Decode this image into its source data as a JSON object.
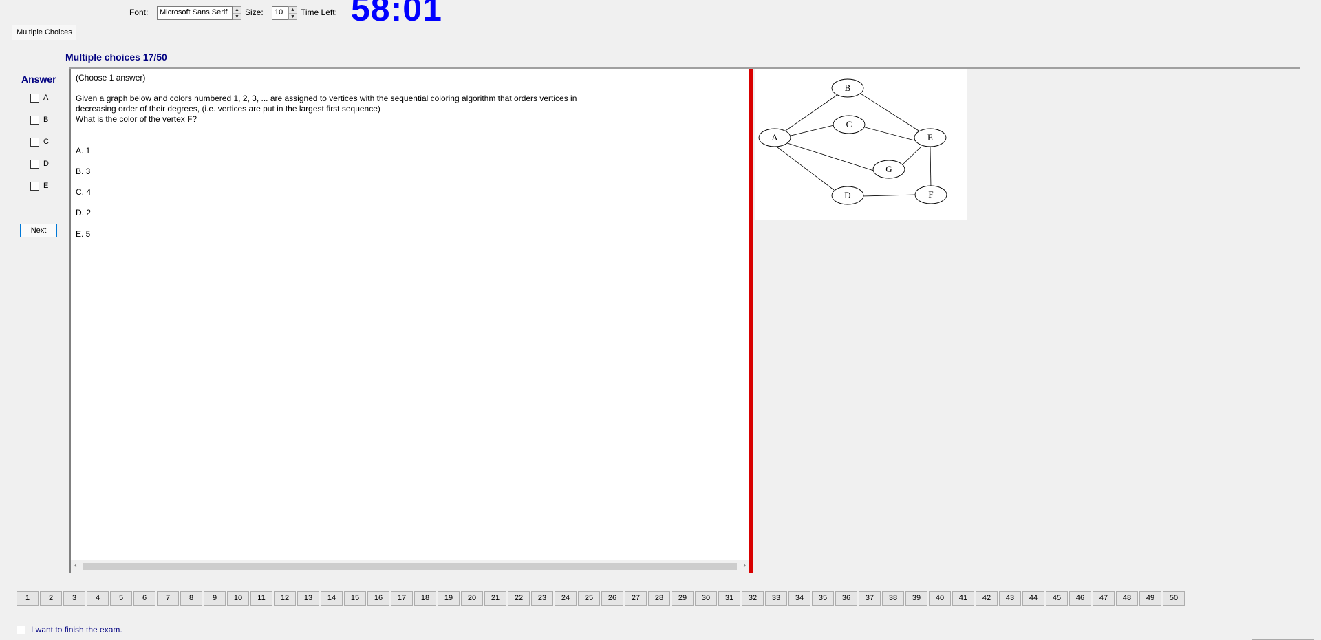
{
  "toolbar": {
    "font_label": "Font:",
    "font_value": "Microsoft Sans Serif",
    "size_label": "Size:",
    "size_value": "10",
    "time_label": "Time Left:",
    "time_value": "58:01"
  },
  "tab_label": "Multiple Choices",
  "section_title": "Multiple choices 17/50",
  "answer_title": "Answer",
  "answer_options": [
    "A",
    "B",
    "C",
    "D",
    "E"
  ],
  "next_label": "Next",
  "question": {
    "instruction": "(Choose 1 answer)",
    "text": "Given a graph below and colors numbered 1, 2, 3, ... are assigned to vertices with the sequential coloring algorithm that orders vertices in\ndecreasing order of their degrees, (i.e. vertices are put in the largest first sequence)\nWhat is the color of the vertex F?",
    "choices": [
      "A. 1",
      "B. 3",
      "C. 4",
      "D. 2",
      "E. 5"
    ]
  },
  "graph": {
    "nodes": [
      "A",
      "B",
      "C",
      "D",
      "E",
      "F",
      "G"
    ]
  },
  "question_numbers": [
    "1",
    "2",
    "3",
    "4",
    "5",
    "6",
    "7",
    "8",
    "9",
    "10",
    "11",
    "12",
    "13",
    "14",
    "15",
    "16",
    "17",
    "18",
    "19",
    "20",
    "21",
    "22",
    "23",
    "24",
    "25",
    "26",
    "27",
    "28",
    "29",
    "30",
    "31",
    "32",
    "33",
    "34",
    "35",
    "36",
    "37",
    "38",
    "39",
    "40",
    "41",
    "42",
    "43",
    "44",
    "45",
    "46",
    "47",
    "48",
    "49",
    "50"
  ],
  "finish_label": "I want to finish the exam."
}
